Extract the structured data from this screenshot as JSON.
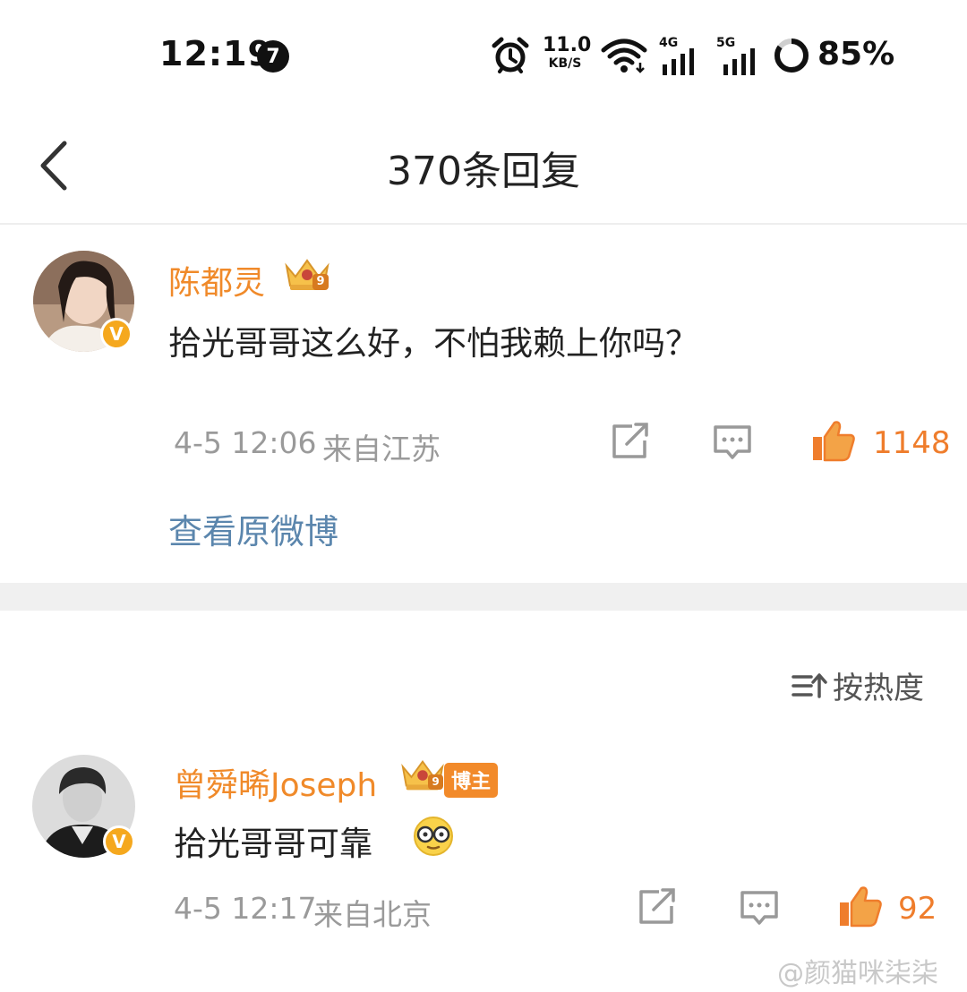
{
  "status_bar": {
    "time": "12:19",
    "notification_count": "7",
    "net_speed_value": "11.0",
    "net_speed_unit": "KB/S",
    "network_4g": "4G",
    "network_5g": "5G",
    "battery_percent": "85%",
    "icons": [
      "alarm-icon",
      "wifi-icon",
      "signal-4g-icon",
      "signal-5g-icon",
      "battery-ring-icon"
    ]
  },
  "header": {
    "back_icon": "chevron-left-icon",
    "title": "370条回复"
  },
  "main_comment": {
    "username": "陈都灵",
    "level_badge": "9",
    "verified": "V",
    "text": "拾光哥哥这么好，不怕我赖上你吗？",
    "time": "4-5 12:06",
    "location": "来自江苏",
    "likes": "1148",
    "view_original": "查看原微博"
  },
  "sort": {
    "label": "按热度",
    "icon": "sort-icon"
  },
  "replies": [
    {
      "username": "曾舜晞Joseph",
      "level_badge": "9",
      "tag": "博主",
      "verified": "V",
      "text": "拾光哥哥可靠",
      "emoji": "glasses-emoji-icon",
      "time": "4-5 12:17",
      "location": "来自北京",
      "likes": "92"
    }
  ],
  "watermark": "@颜猫咪柒柒",
  "colors": {
    "username": "#f08a2a",
    "like": "#ef7d2c",
    "link": "#5b86ad",
    "meta": "#9a9a9a",
    "verified_badge": "#f5a81e"
  }
}
